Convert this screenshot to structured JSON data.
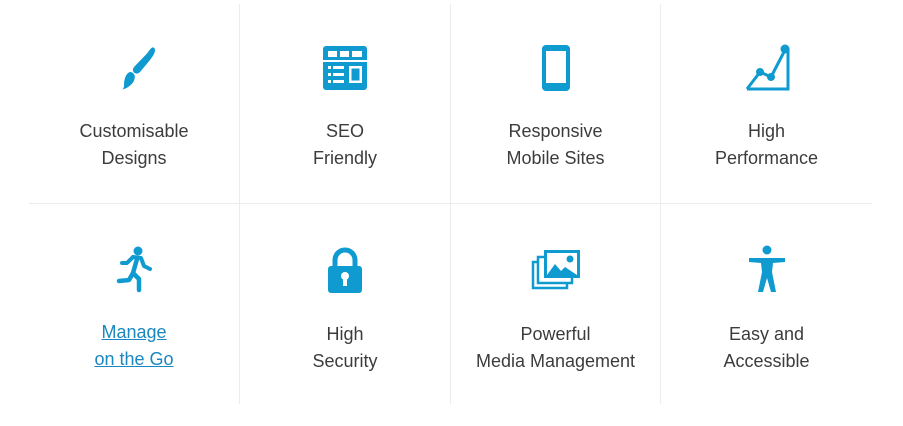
{
  "accent_color": "#0f9ad0",
  "features": [
    {
      "icon": "paintbrush-icon",
      "line1": "Customisable",
      "line2": "Designs"
    },
    {
      "icon": "seo-layout-icon",
      "line1": "SEO",
      "line2": "Friendly"
    },
    {
      "icon": "mobile-phone-icon",
      "line1": "Responsive",
      "line2": "Mobile Sites"
    },
    {
      "icon": "performance-chart-icon",
      "line1": "High",
      "line2": "Performance"
    },
    {
      "icon": "running-person-icon",
      "line1": "Manage",
      "line2": "on the Go"
    },
    {
      "icon": "padlock-icon",
      "line1": "High",
      "line2": "Security"
    },
    {
      "icon": "media-stack-icon",
      "line1": "Powerful",
      "line2": "Media Management"
    },
    {
      "icon": "accessibility-person-icon",
      "line1": "Easy and",
      "line2": "Accessible"
    }
  ]
}
